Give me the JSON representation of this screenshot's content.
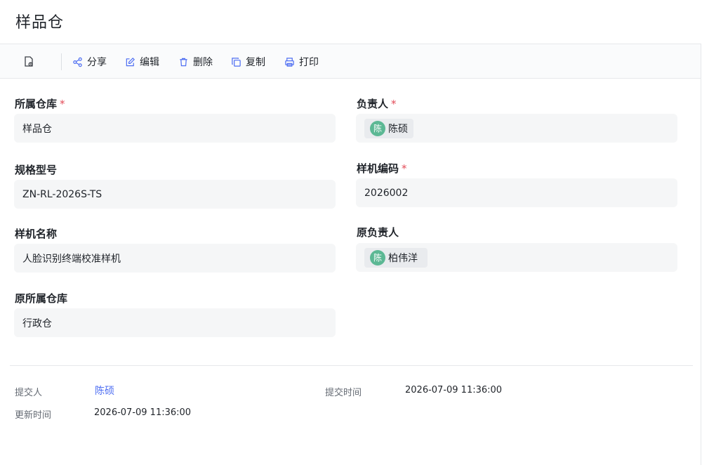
{
  "page": {
    "title": "样品仓"
  },
  "toolbar": {
    "share": "分享",
    "edit": "编辑",
    "delete": "删除",
    "copy": "复制",
    "print": "打印"
  },
  "fields": {
    "warehouse": {
      "label": "所属仓库",
      "required": "*",
      "value": "样品仓"
    },
    "owner": {
      "label": "负责人",
      "required": "*",
      "avatar": "陈",
      "value": "陈硕"
    },
    "spec": {
      "label": "规格型号",
      "value": "ZN-RL-2026S-TS"
    },
    "sample_code": {
      "label": "样机编码",
      "required": "*",
      "value": "2026002"
    },
    "sample_name": {
      "label": "样机名称",
      "value": "人脸识别终端校准样机"
    },
    "original_owner": {
      "label": "原负责人",
      "avatar": "陈",
      "value": "柏伟洋"
    },
    "original_warehouse": {
      "label": "原所属仓库",
      "value": "行政仓"
    }
  },
  "meta": {
    "submitter_label": "提交人",
    "submitter_value": "陈硕",
    "submit_time_label": "提交时间",
    "submit_time_value": "2026-07-09 11:36:00",
    "update_time_label": "更新时间",
    "update_time_value": "2026-07-09 11:36:00"
  },
  "colors": {
    "accent": "#4e6ef2",
    "required": "#e34d59",
    "avatar": "#5cb894"
  },
  "icons": [
    "record-icon",
    "share-icon",
    "edit-icon",
    "delete-icon",
    "copy-icon",
    "print-icon"
  ]
}
